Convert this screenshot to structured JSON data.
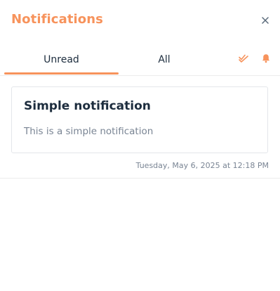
{
  "header": {
    "title": "Notifications",
    "close_icon": "close-icon"
  },
  "tabs": [
    {
      "label": "Unread",
      "active": true
    },
    {
      "label": "All",
      "active": false
    }
  ],
  "actions": {
    "mark_all_read_icon": "double-check-icon",
    "bell_icon": "bell-icon"
  },
  "notifications": [
    {
      "title": "Simple notification",
      "body": "This is a simple notification",
      "timestamp": "Tuesday, May 6, 2025 at 12:18 PM"
    }
  ],
  "colors": {
    "accent": "#f7935c",
    "text_dark": "#1d2d3e",
    "text_muted": "#7a8594",
    "border": "#e4e6ea"
  }
}
